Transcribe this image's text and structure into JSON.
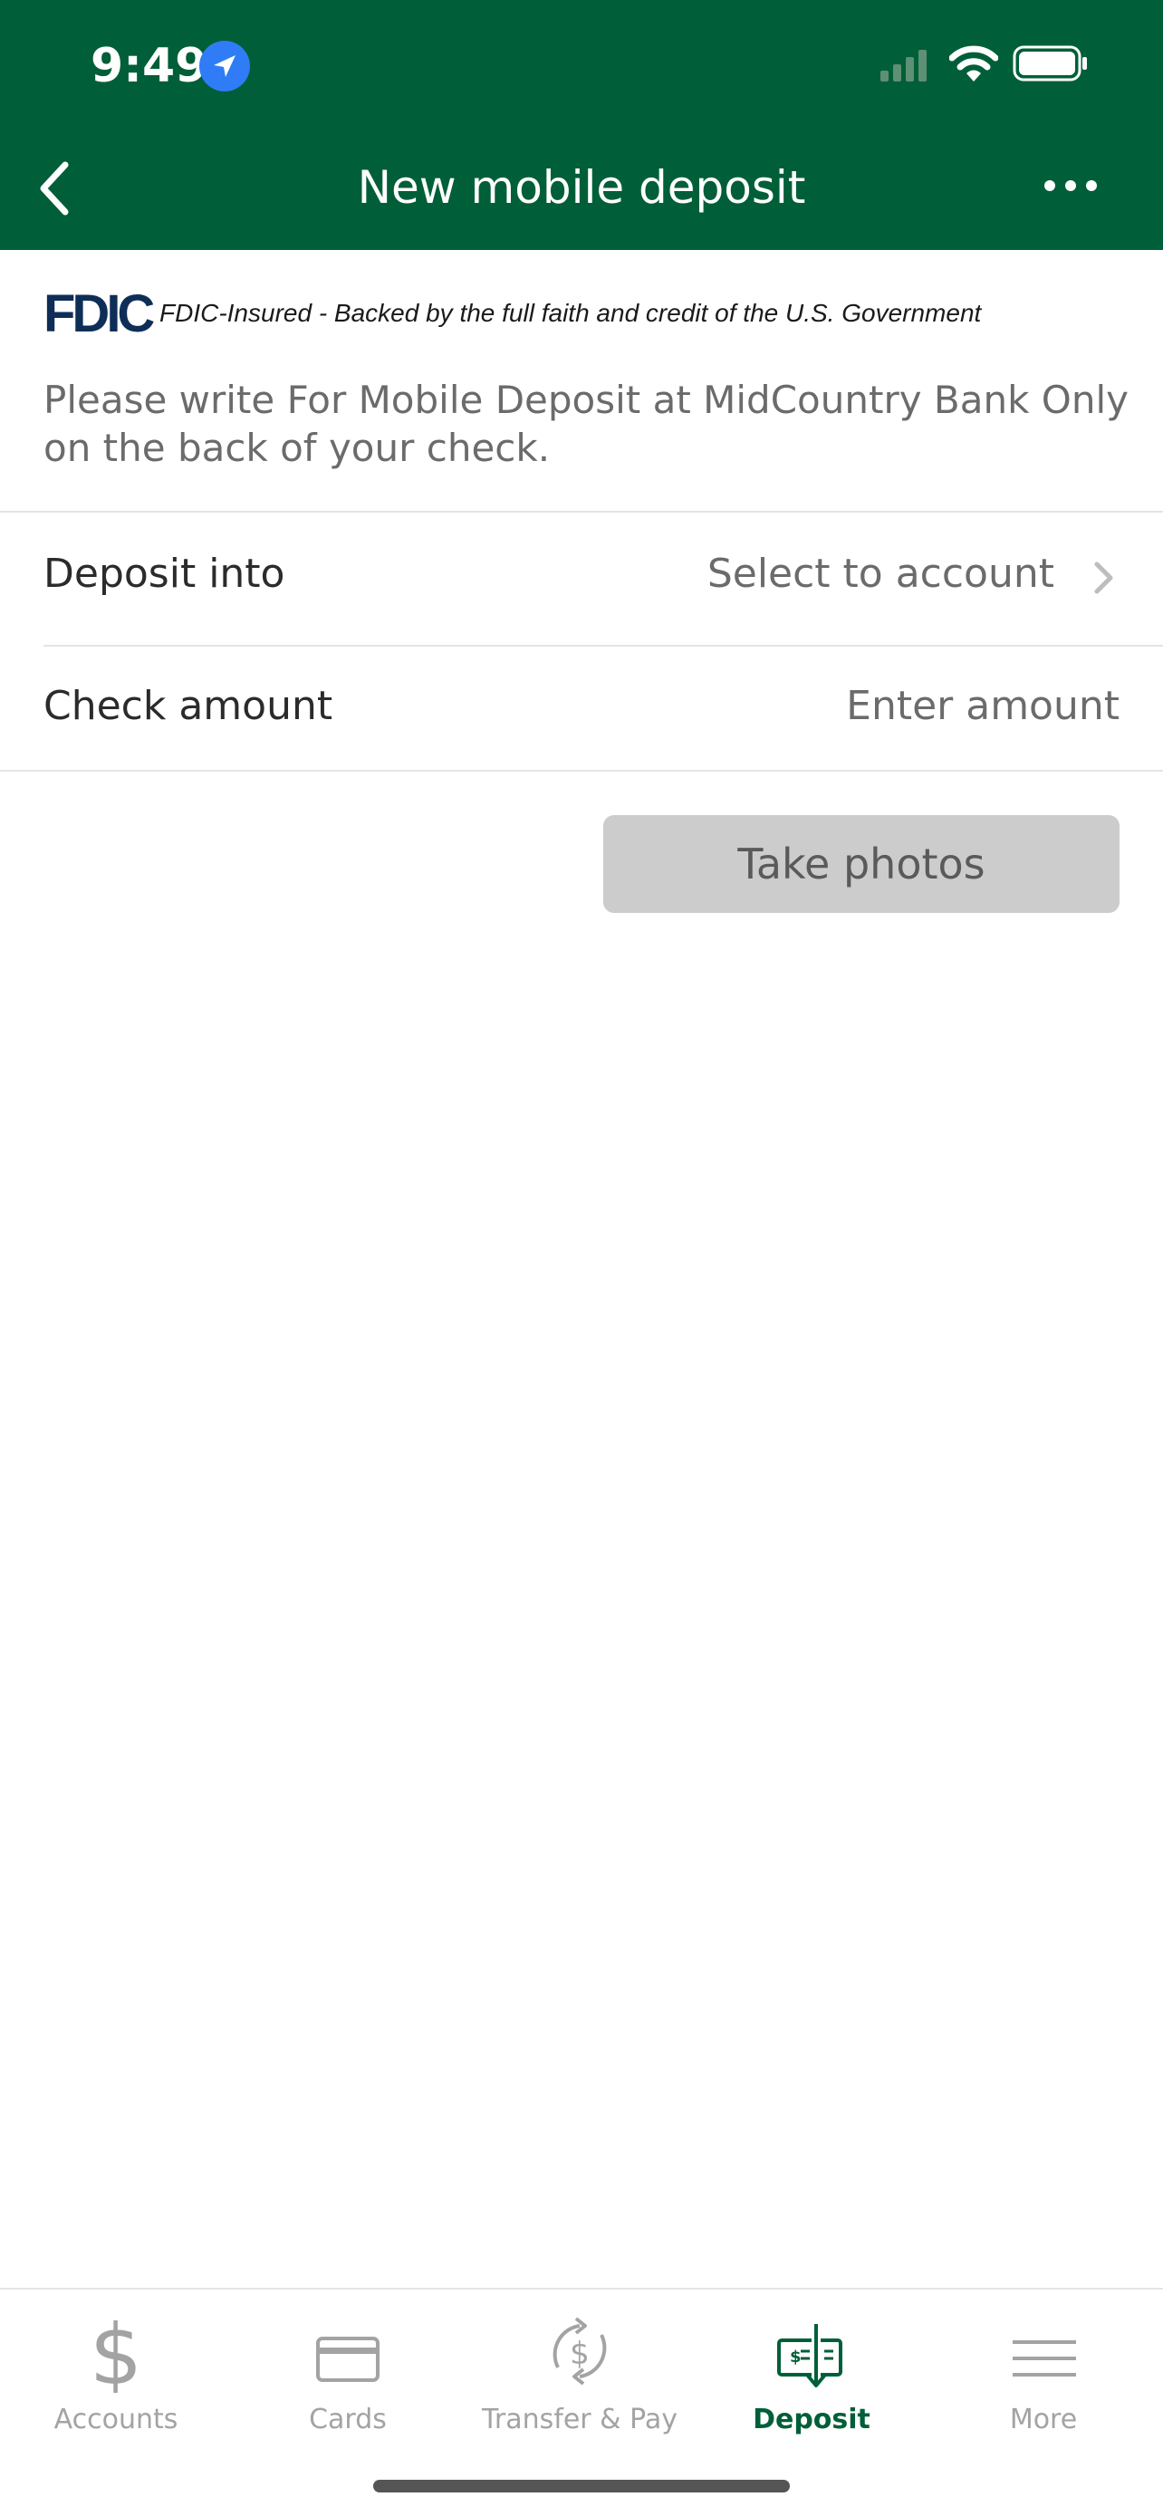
{
  "status_bar": {
    "time": "9:49"
  },
  "header": {
    "title": "New mobile deposit"
  },
  "fdic": {
    "logo_text": "FDIC",
    "notice": "FDIC-Insured - Backed by the full faith and credit of the U.S. Government"
  },
  "instructions": "Please write For Mobile Deposit at MidCountry Bank Only on the back of your check.",
  "form": {
    "deposit_into": {
      "label": "Deposit into",
      "value": "Select to account"
    },
    "check_amount": {
      "label": "Check amount",
      "placeholder": "Enter amount"
    },
    "take_photos_label": "Take photos"
  },
  "tabs": [
    {
      "label": "Accounts",
      "icon": "dollar-icon"
    },
    {
      "label": "Cards",
      "icon": "card-icon"
    },
    {
      "label": "Transfer & Pay",
      "icon": "transfer-icon"
    },
    {
      "label": "Deposit",
      "icon": "check-deposit-icon"
    },
    {
      "label": "More",
      "icon": "menu-icon"
    }
  ],
  "colors": {
    "brand_green": "#005f38",
    "disabled_button": "#cccccc",
    "inactive_tab": "#a3a3a3",
    "location_blue": "#2f7cf6"
  }
}
